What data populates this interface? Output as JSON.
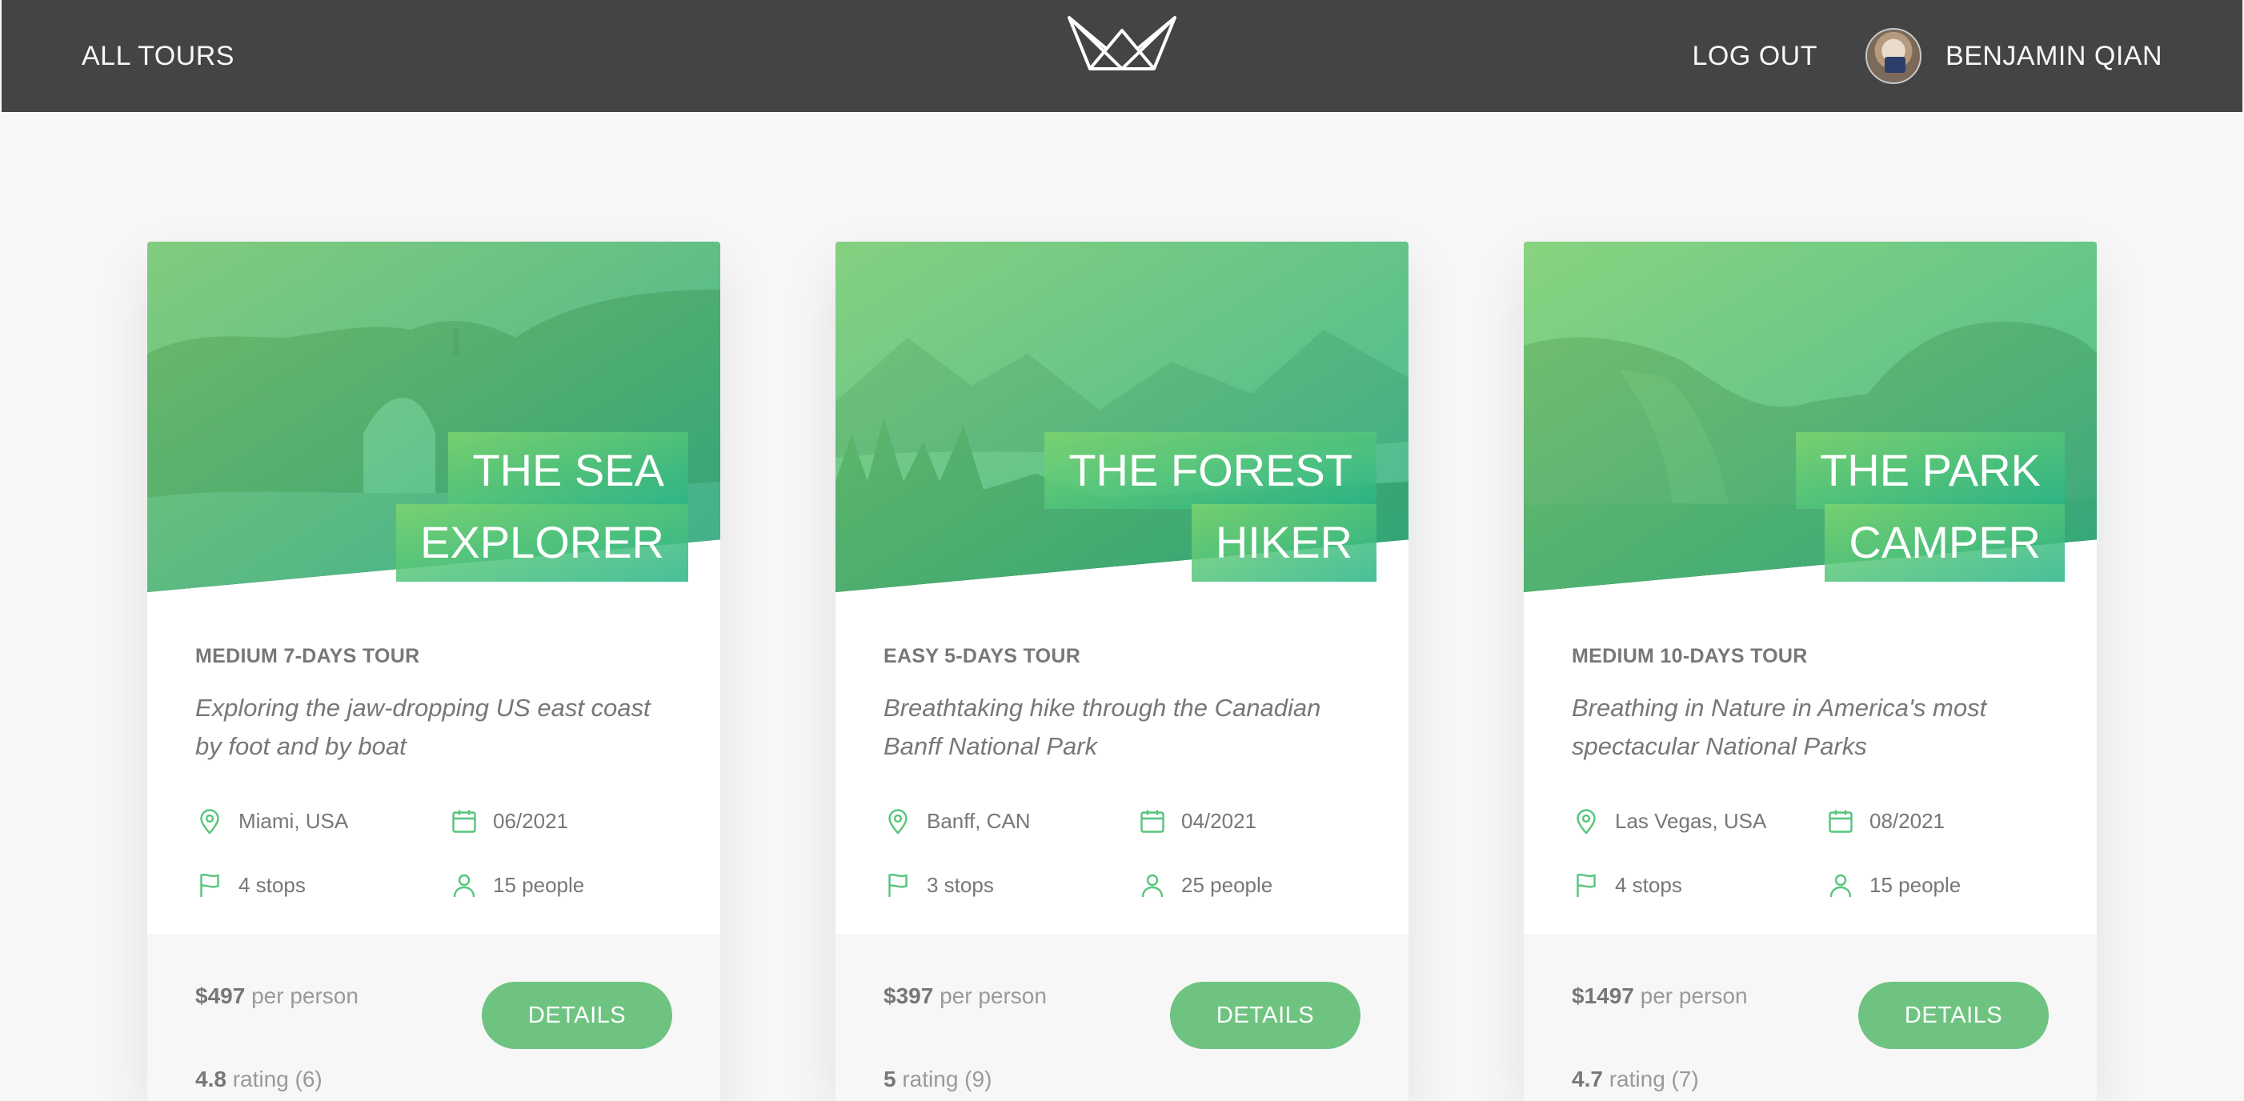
{
  "header": {
    "all_tours": "ALL TOURS",
    "logout": "LOG OUT",
    "user_name": "BENJAMIN QIAN"
  },
  "colors": {
    "header_bg": "#444444",
    "accent": "#6fc381",
    "page_bg": "#f7f7f7"
  },
  "tours": [
    {
      "title_line1": "THE SEA",
      "title_line2": "EXPLORER",
      "subheading": "MEDIUM 7-DAYS TOUR",
      "summary": "Exploring the jaw-dropping US east coast by foot and by boat",
      "location": "Miami, USA",
      "date": "06/2021",
      "stops": "4 stops",
      "people": "15 people",
      "price": "$497",
      "price_suffix": "per person",
      "rating": "4.8",
      "rating_suffix": "rating (6)",
      "button": "DETAILS"
    },
    {
      "title_line1": "THE FOREST",
      "title_line2": "HIKER",
      "subheading": "EASY 5-DAYS TOUR",
      "summary": "Breathtaking hike through the Canadian Banff National Park",
      "location": "Banff, CAN",
      "date": "04/2021",
      "stops": "3 stops",
      "people": "25 people",
      "price": "$397",
      "price_suffix": "per person",
      "rating": "5",
      "rating_suffix": "rating (9)",
      "button": "DETAILS"
    },
    {
      "title_line1": "THE PARK",
      "title_line2": "CAMPER",
      "subheading": "MEDIUM 10-DAYS TOUR",
      "summary": "Breathing in Nature in America's most spectacular National Parks",
      "location": "Las Vegas, USA",
      "date": "08/2021",
      "stops": "4 stops",
      "people": "15 people",
      "price": "$1497",
      "price_suffix": "per person",
      "rating": "4.7",
      "rating_suffix": "rating (7)",
      "button": "DETAILS"
    }
  ],
  "icons": {
    "logo": "crown-logo-icon",
    "location": "map-pin-icon",
    "date": "calendar-icon",
    "stops": "flag-icon",
    "people": "user-icon"
  }
}
